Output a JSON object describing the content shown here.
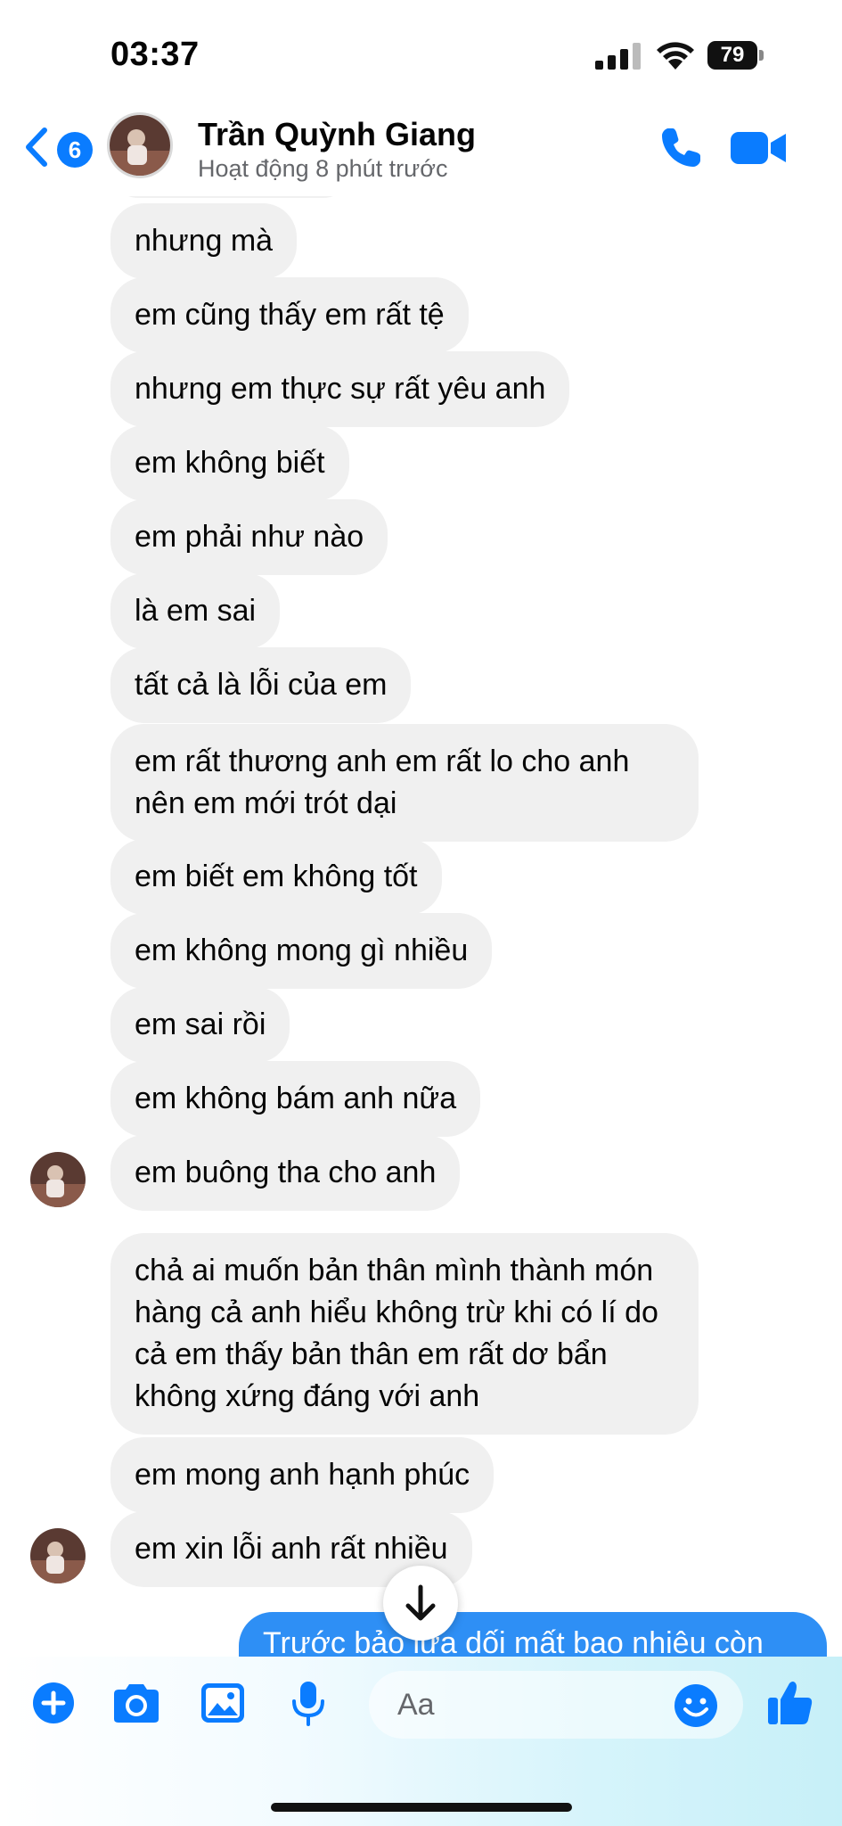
{
  "status_bar": {
    "time": "03:37",
    "battery": "79"
  },
  "header": {
    "back_badge": "6",
    "contact_name": "Trần Quỳnh Giang",
    "active_status": "Hoạt động 8 phút trước"
  },
  "messages": [
    {
      "text": "nhưng mà"
    },
    {
      "text": "em cũng thấy em rất tệ"
    },
    {
      "text": "nhưng em thực sự rất yêu anh"
    },
    {
      "text": "em không biết"
    },
    {
      "text": "em phải như nào"
    },
    {
      "text": "là em sai"
    },
    {
      "text": "tất cả là lỗi của em"
    },
    {
      "text": "em rất thương anh em rất lo cho anh nên em mới trót dại"
    },
    {
      "text": "em biết em không tốt"
    },
    {
      "text": "em không mong gì nhiều"
    },
    {
      "text": "em sai rồi"
    },
    {
      "text": "em không bám anh nữa"
    },
    {
      "text": "em buông tha cho anh"
    },
    {
      "text": "chả ai muốn bản thân mình thành món hàng cả anh hiểu không trừ khi có lí do cả em thấy bản thân em rất dơ bẩn không xứng đáng với anh"
    },
    {
      "text": "em mong anh hạnh phúc"
    },
    {
      "text": "em xin lỗi anh rất nhiều"
    }
  ],
  "sent_message": {
    "text": "Trước bảo lừa dối mất bao nhiêu còn"
  },
  "composer": {
    "placeholder": "Aa"
  },
  "colors": {
    "accent": "#0a7cff",
    "received_bubble": "#f0f0f0",
    "sent_bubble": "#2e8ff5"
  }
}
